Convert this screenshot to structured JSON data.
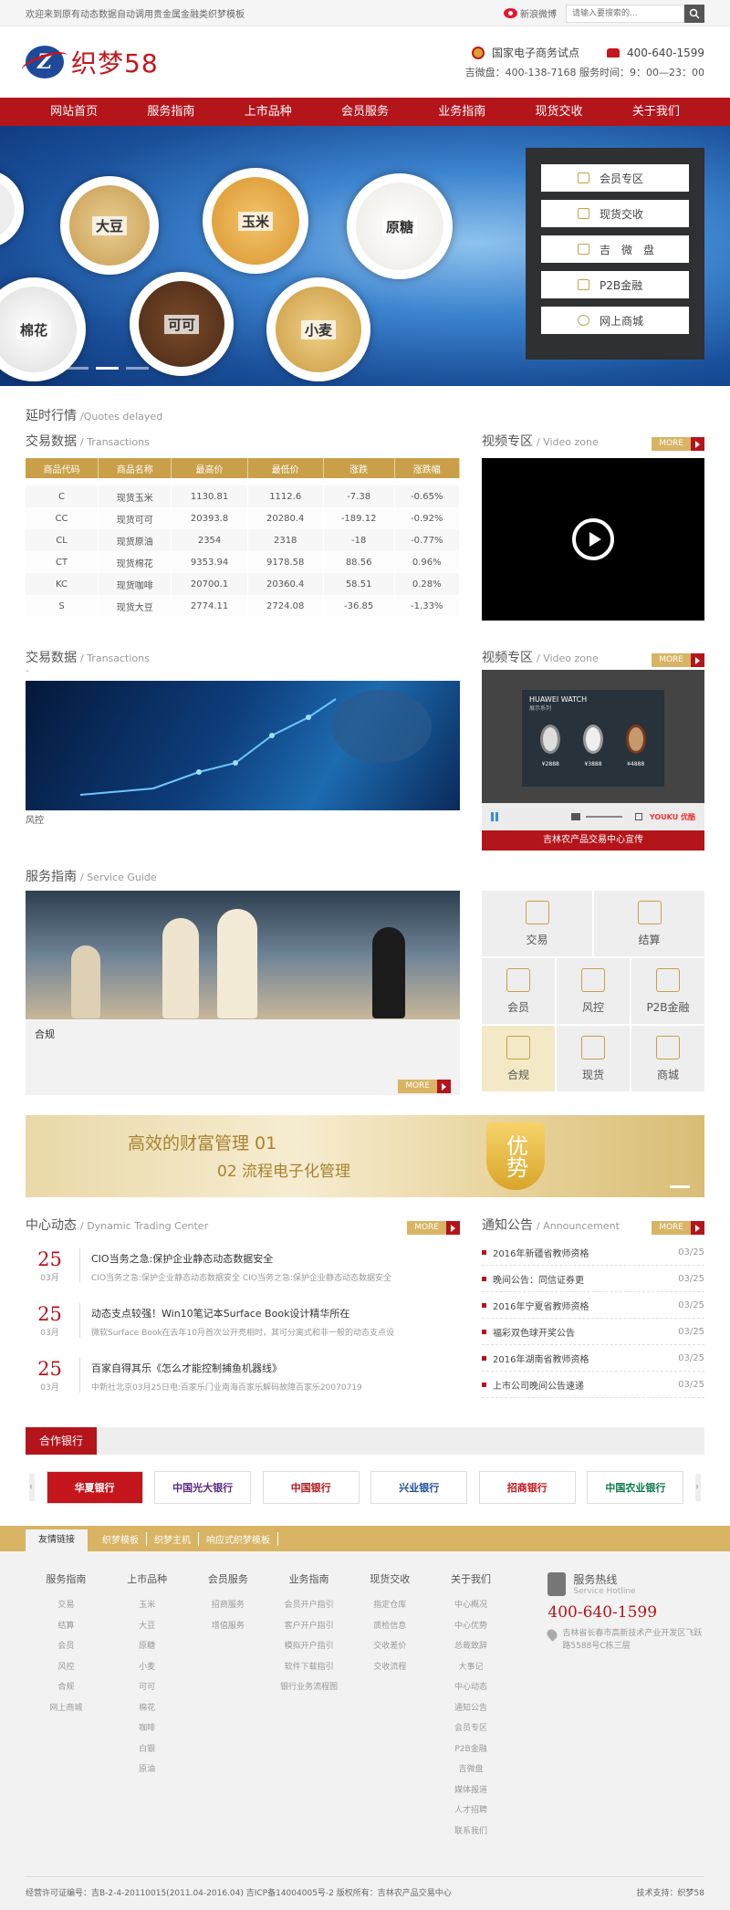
{
  "topbar": {
    "welcome": "欢迎来到原有动态数据自动调用贵金属金融类织梦模板",
    "weibo": "新浪微博",
    "search_placeholder": "请输入要搜索的..."
  },
  "header": {
    "logo_text": "织梦58",
    "logo_letter": "Z",
    "pilot": "国家电子商务试点",
    "hotline": "400-640-1599",
    "consult": "吉微盘：400-138-7168 服务时间：9：00—23：00"
  },
  "nav": [
    "网站首页",
    "服务指南",
    "上市品种",
    "会员服务",
    "业务指南",
    "现货交收",
    "关于我们"
  ],
  "banner": {
    "products": [
      "大豆",
      "玉米",
      "原糖",
      "棉花",
      "可可",
      "小麦"
    ],
    "buttons": [
      "会员专区",
      "现货交收",
      "吉　微　盘",
      "P2B金融",
      "网上商城"
    ]
  },
  "delayed": {
    "cn": "延时行情",
    "en": "/Quotes delayed"
  },
  "transactions": {
    "cn": "交易数据",
    "en": "/ Transactions",
    "headers": [
      "商品代码",
      "商品名称",
      "最高价",
      "最低价",
      "涨跌",
      "涨跌幅"
    ],
    "rows": [
      [
        "C",
        "现货玉米",
        "1130.81",
        "1112.6",
        "-7.38",
        "-0.65%"
      ],
      [
        "CC",
        "现货可可",
        "20393.8",
        "20280.4",
        "-189.12",
        "-0.92%"
      ],
      [
        "CL",
        "现货原油",
        "2354",
        "2318",
        "-18",
        "-0.77%"
      ],
      [
        "CT",
        "现货棉花",
        "9353.94",
        "9178.58",
        "88.56",
        "0.96%"
      ],
      [
        "KC",
        "现货咖啡",
        "20700.1",
        "20360.4",
        "58.51",
        "0.28%"
      ],
      [
        "S",
        "现货大豆",
        "2774.11",
        "2724.08",
        "-36.85",
        "-1.33%"
      ]
    ]
  },
  "video": {
    "cn": "视频专区",
    "en": "/ Video zone",
    "more": "MORE"
  },
  "transactions2": {
    "cn": "交易数据",
    "en": "/ Transactions",
    "dash": "-",
    "caption": "风控"
  },
  "video2": {
    "cn": "视频专区",
    "en": "/ Video zone",
    "more": "MORE",
    "brand": "HUAWEI WATCH",
    "sub": "展示系列",
    "prices": [
      "¥2888",
      "¥3888",
      "¥4888"
    ],
    "youku": "YOUKU 优酷",
    "caption": "吉林农产品交易中心宣传"
  },
  "service": {
    "cn": "服务指南",
    "en": "/ Service Guide",
    "caption": "合规",
    "more": "MORE",
    "items": [
      "交易",
      "结算",
      "会员",
      "风控",
      "P2B金融",
      "合规",
      "现货",
      "商城"
    ]
  },
  "ad": {
    "line1": "高效的财富管理 01",
    "line2": "02 流程电子化管理",
    "badge": "优势"
  },
  "dynamic": {
    "cn": "中心动态",
    "en": "/ Dynamic Trading Center",
    "more": "MORE",
    "items": [
      {
        "day": "25",
        "month": "03月",
        "title": "CIO当务之急:保护企业静态动态数据安全",
        "summary": "CIO当务之急:保护企业静态动态数据安全 CIO当务之急:保护企业静态动态数据安全"
      },
      {
        "day": "25",
        "month": "03月",
        "title": "动态支点较强！Win10笔记本Surface Book设计精华所在",
        "summary": "微软Surface Book在去年10月首次公开亮相时，其可分离式和非一般的动态支点设"
      },
      {
        "day": "25",
        "month": "03月",
        "title": "百家自得其乐《怎么才能控制捕鱼机器线》",
        "summary": "中新社北京03月25日电:百家乐门业南海百家乐解码故障百家乐20070719"
      }
    ]
  },
  "notice": {
    "cn": "通知公告",
    "en": "/ Announcement",
    "more": "MORE",
    "items": [
      {
        "t": "2016年新疆省教师资格",
        "d": "03/25"
      },
      {
        "t": "晚间公告：同信证券更",
        "d": "03/25"
      },
      {
        "t": "2016年宁夏省教师资格",
        "d": "03/25"
      },
      {
        "t": "福彩双色球开奖公告",
        "d": "03/25"
      },
      {
        "t": "2016年湖南省教师资格",
        "d": "03/25"
      },
      {
        "t": "上市公司晚间公告速递",
        "d": "03/25"
      }
    ]
  },
  "banks": {
    "title": "合作银行",
    "items": [
      "华夏银行",
      "中国光大银行",
      "中国银行",
      "兴业银行",
      "招商银行",
      "中国农业银行"
    ]
  },
  "links": {
    "tab": "友情链接",
    "items": [
      "织梦模板",
      "织梦主机",
      "响应式织梦模板"
    ]
  },
  "footer": {
    "columns": [
      {
        "title": "服务指南",
        "items": [
          "交易",
          "结算",
          "会员",
          "风控",
          "合规",
          "网上商城"
        ]
      },
      {
        "title": "上市品种",
        "items": [
          "玉米",
          "大豆",
          "原糖",
          "小麦",
          "可可",
          "棉花",
          "咖啡",
          "白银",
          "原油"
        ]
      },
      {
        "title": "会员服务",
        "items": [
          "招商服务",
          "增值服务"
        ]
      },
      {
        "title": "业务指南",
        "items": [
          "会员开户指引",
          "客户开户指引",
          "模拟开户指引",
          "软件下载指引",
          "银行业务流程图"
        ]
      },
      {
        "title": "现货交收",
        "items": [
          "指定仓库",
          "质检信息",
          "交收差价",
          "交收流程"
        ]
      },
      {
        "title": "关于我们",
        "items": [
          "中心概况",
          "中心优势",
          "总裁致辞",
          "大事记",
          "中心动态",
          "通知公告",
          "会员专区",
          "P2B金融",
          "吉微盘",
          "媒体报道",
          "人才招聘",
          "联系我们"
        ]
      }
    ],
    "hotline_title": "服务热线",
    "hotline_en": "Service Hotline",
    "hotline": "400-640-1599",
    "address": "吉林省长春市高新技术产业开发区飞跃路5588号C栋三层",
    "copyright": "经营许可证编号：吉B-2-4-20110015(2011.04-2016.04) 吉ICP备14004005号-2 版权所有：吉林农产品交易中心",
    "support": "技术支持：织梦58"
  },
  "colors": {
    "red": "#b4151b",
    "gold": "#c9a049"
  }
}
